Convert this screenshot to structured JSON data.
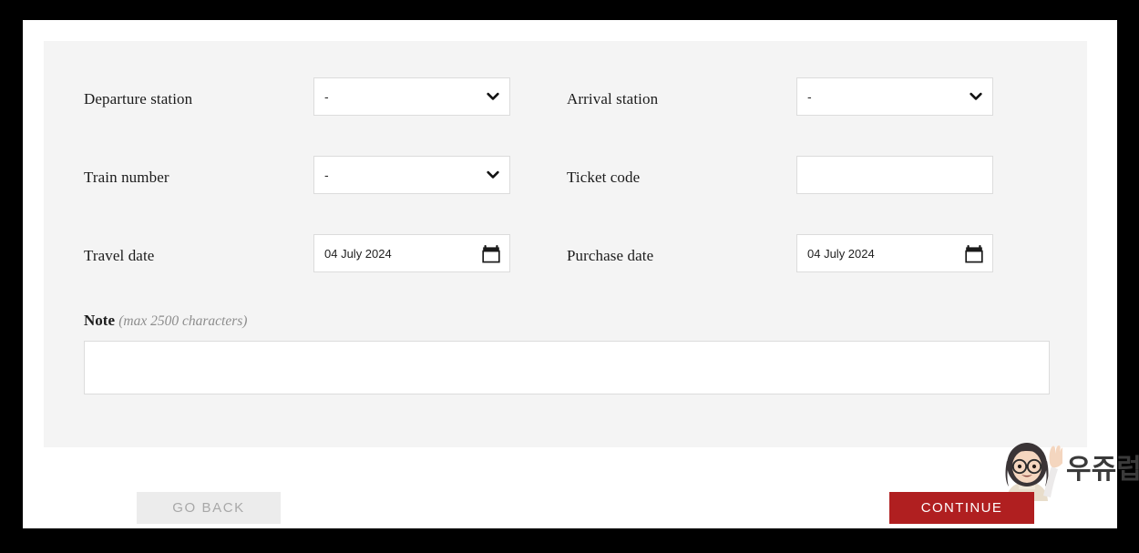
{
  "form": {
    "rows": [
      {
        "left": {
          "label": "Departure station",
          "type": "select",
          "value": "-",
          "icon": "chevron-down-icon",
          "name": "departure-station"
        },
        "right": {
          "label": "Arrival station",
          "type": "select",
          "value": "-",
          "icon": "chevron-down-icon",
          "name": "arrival-station"
        }
      },
      {
        "left": {
          "label": "Train number",
          "type": "select",
          "value": "-",
          "icon": "chevron-down-icon",
          "name": "train-number"
        },
        "right": {
          "label": "Ticket code",
          "type": "text",
          "value": "",
          "placeholder": "",
          "name": "ticket-code"
        }
      },
      {
        "left": {
          "label": "Travel date",
          "type": "date",
          "value": "04 July 2024",
          "icon": "calendar-icon",
          "name": "travel-date"
        },
        "right": {
          "label": "Purchase date",
          "type": "date",
          "value": "04 July 2024",
          "icon": "calendar-icon",
          "name": "purchase-date"
        }
      }
    ]
  },
  "note": {
    "title": "Note",
    "hint": "(max 2500 characters)",
    "value": "",
    "placeholder": ""
  },
  "footer": {
    "back_label": "GO BACK",
    "continue_label": "CONTINUE"
  },
  "watermark": {
    "text": "우쥬럽",
    "avatar_icon": "waving-woman-avatar-icon"
  },
  "colors": {
    "accent_red": "#b01f20",
    "panel_bg": "#f4f4f4",
    "page_bg": "#ffffff",
    "frame": "#000000",
    "disabled_text": "#a8a8a8",
    "hint_text": "#8d8d8d"
  }
}
